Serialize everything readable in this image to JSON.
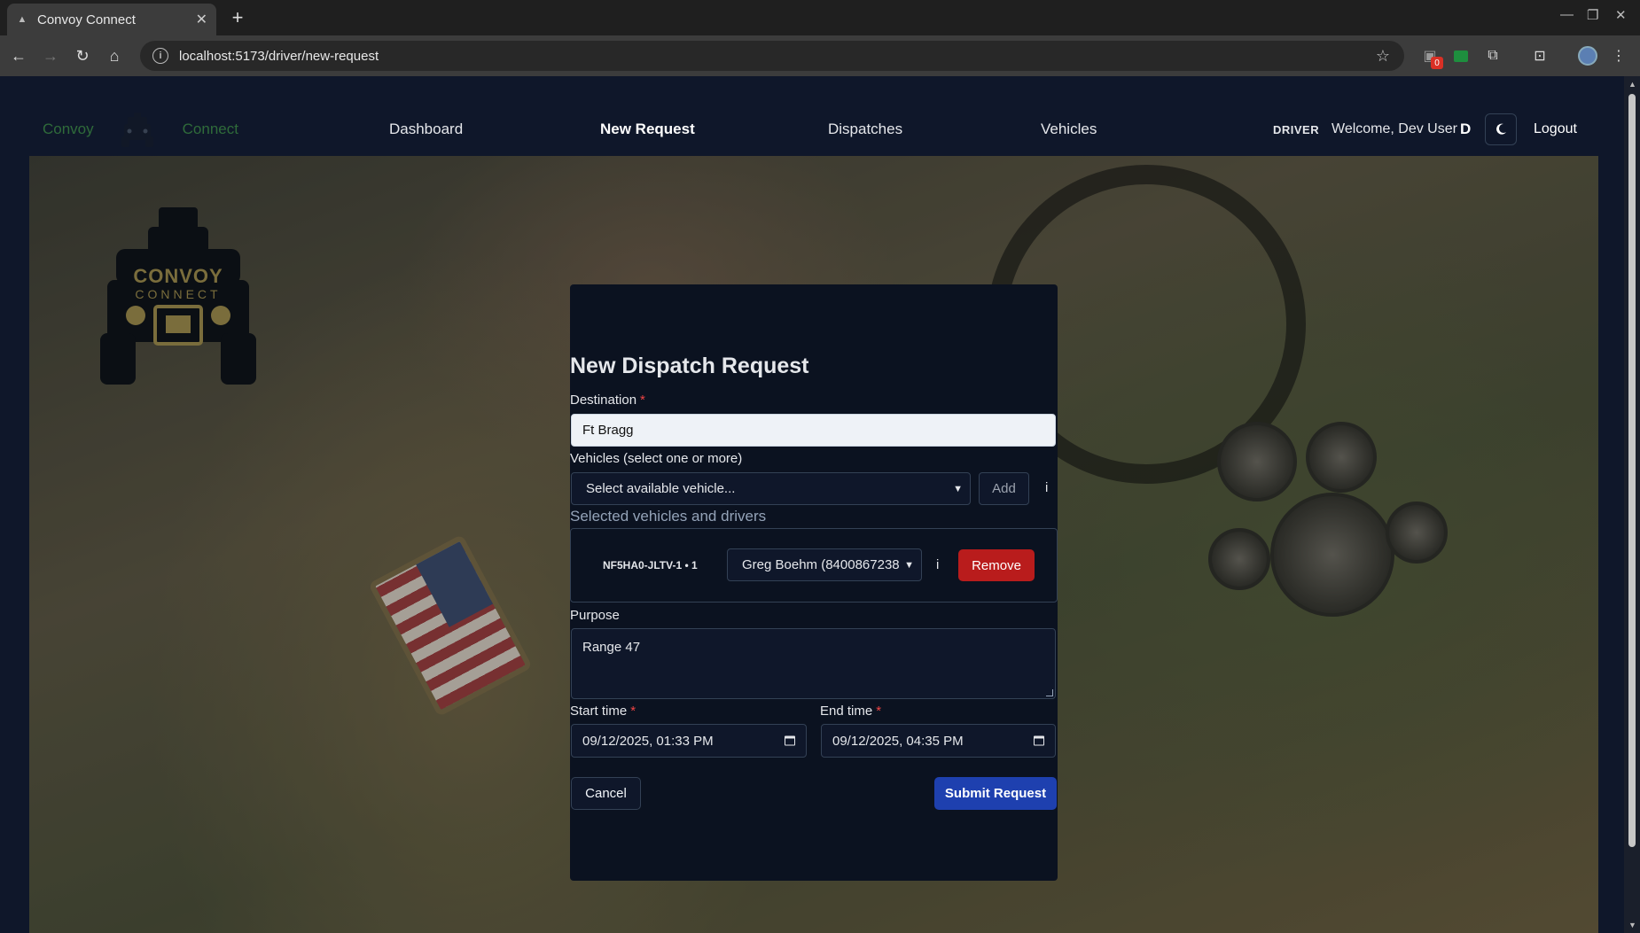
{
  "browser": {
    "tab_title": "Convoy Connect",
    "url": "localhost:5173/driver/new-request",
    "extension_badge": "0"
  },
  "nav": {
    "brand_left": "Convoy",
    "brand_right": "Connect",
    "links": [
      "Dashboard",
      "New Request",
      "Dispatches",
      "Vehicles"
    ],
    "active": "New Request",
    "role": "DRIVER",
    "welcome": "Welcome, Dev User",
    "initial": "D",
    "logout": "Logout"
  },
  "hero_logo": {
    "line1": "CONVOY",
    "line2": "CONNECT"
  },
  "form": {
    "heading": "New Dispatch Request",
    "destination_label": "Destination",
    "destination_value": "Ft Bragg",
    "vehicles_label": "Vehicles (select one or more)",
    "vehicle_select_placeholder": "Select available vehicle...",
    "add_label": "Add",
    "info_glyph": "i",
    "selected_label": "Selected vehicles and drivers",
    "selected": [
      {
        "vehicle": "NF5HA0-JLTV-1 • 1",
        "driver": "Greg Boehm (8400867238",
        "remove_label": "Remove"
      }
    ],
    "purpose_label": "Purpose",
    "purpose_value": "Range 47",
    "start_label": "Start time",
    "start_value": "09/12/2025, 01:33 PM",
    "end_label": "End time",
    "end_value": "09/12/2025, 04:35 PM",
    "cancel_label": "Cancel",
    "submit_label": "Submit Request",
    "required_marker": "*"
  },
  "colors": {
    "page_bg": "#0f172a",
    "brand_green": "#2f6b3a",
    "remove_red": "#b91c1c",
    "submit_blue": "#1e40af",
    "required_red": "#ef4444"
  }
}
